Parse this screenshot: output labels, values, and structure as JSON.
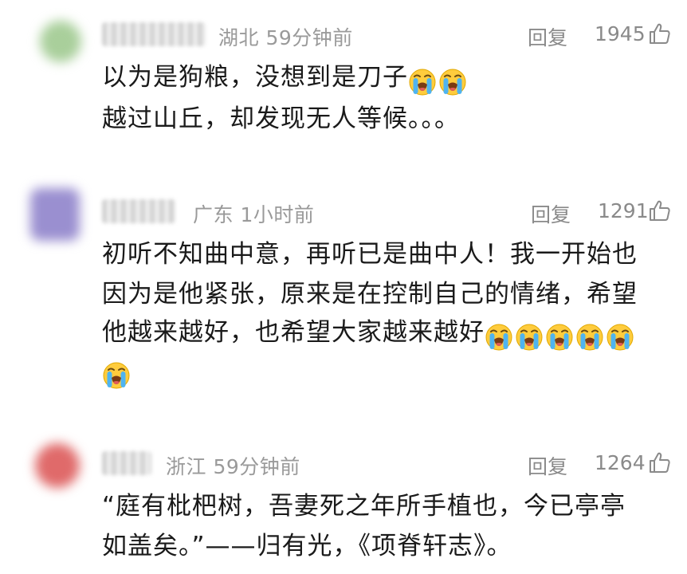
{
  "comments": [
    {
      "avatar_color": "#a9cf9b",
      "location": "湖北",
      "time": "59分钟前",
      "reply_label": "回复",
      "likes": "1945",
      "like_icon": "thumbs-up-icon",
      "lines": [
        "以为是狗粮，没想到是刀子",
        "越过山丘，却发现无人等候。。。"
      ],
      "emoji": "loudly-crying-face",
      "emoji_count_line1": 2
    },
    {
      "avatar_color": "#9a8fd0",
      "location": "广东",
      "time": "1小时前",
      "reply_label": "回复",
      "likes": "1291",
      "like_icon": "thumbs-up-icon",
      "lines": [
        "初听不知曲中意，再听已是曲中人！我一开始也",
        "因为是他紧张，原来是在控制自己的情绪，希望",
        "他越来越好，也希望大家越来越好"
      ],
      "emoji": "loudly-crying-face",
      "emoji_count_line3": 5,
      "emoji_count_line4": 1
    },
    {
      "avatar_color": "#e06a6a",
      "location": "浙江",
      "time": "59分钟前",
      "reply_label": "回复",
      "likes": "1264",
      "like_icon": "thumbs-up-icon",
      "lines": [
        "“庭有枇杷树，吾妻死之年所手植也，今已亭亭",
        "如盖矣。”——归有光，《项脊轩志》。"
      ]
    }
  ],
  "colors": {
    "text": "#1a1a1a",
    "meta": "#9a9a9a",
    "action": "#8a8a8a"
  }
}
